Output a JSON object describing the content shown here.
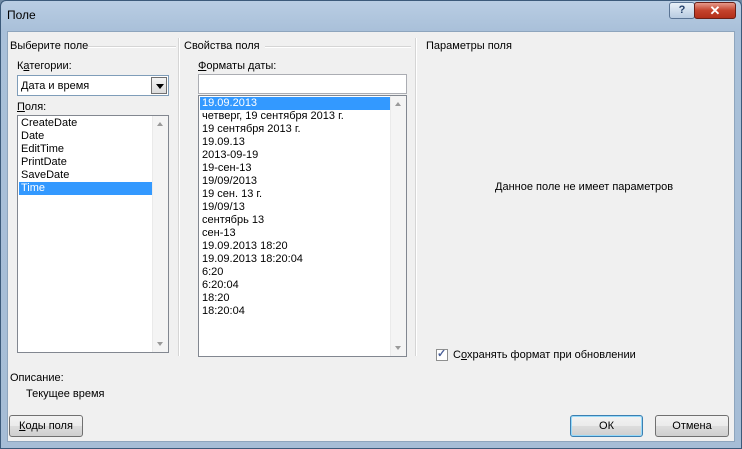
{
  "window": {
    "title": "Поле",
    "help_label": "?",
    "close_label": "✕"
  },
  "left_group": {
    "title": "Выберите поле",
    "categories_label_pre": "К",
    "categories_label_ul": "а",
    "categories_label_post": "тегории:",
    "categories_value": "Дата и время",
    "fields_label_ul": "П",
    "fields_label_post": "оля:",
    "fields": [
      "CreateDate",
      "Date",
      "EditTime",
      "PrintDate",
      "SaveDate",
      "Time"
    ],
    "selected_field": "Time"
  },
  "middle_group": {
    "title": "Свойства поля",
    "formats_label_ul": "Ф",
    "formats_label_post": "орматы даты:",
    "format_input_value": "",
    "formats": [
      "19.09.2013",
      "четверг, 19 сентября 2013 г.",
      "19 сентября 2013 г.",
      "19.09.13",
      "2013-09-19",
      "19-сен-13",
      "19/09/2013",
      "19 сен. 13 г.",
      "19/09/13",
      "сентябрь 13",
      "сен-13",
      "19.09.2013 18:20",
      "19.09.2013 18:20:04",
      "6:20",
      "6:20:04",
      "18:20",
      "18:20:04"
    ],
    "selected_format": "19.09.2013"
  },
  "right_group": {
    "title": "Параметры поля",
    "no_params_text": "Данное поле не имеет параметров",
    "preserve_label_pre": "С",
    "preserve_label_ul": "о",
    "preserve_label_post": "хранять формат при обновлении",
    "preserve_checked": true
  },
  "description": {
    "label": "Описание:",
    "text": "Текущее время"
  },
  "buttons": {
    "field_codes_ul": "К",
    "field_codes_post": "оды поля",
    "ok": "ОК",
    "cancel": "Отмена"
  },
  "colors": {
    "selection": "#3399ff",
    "close": "#c4422c"
  }
}
